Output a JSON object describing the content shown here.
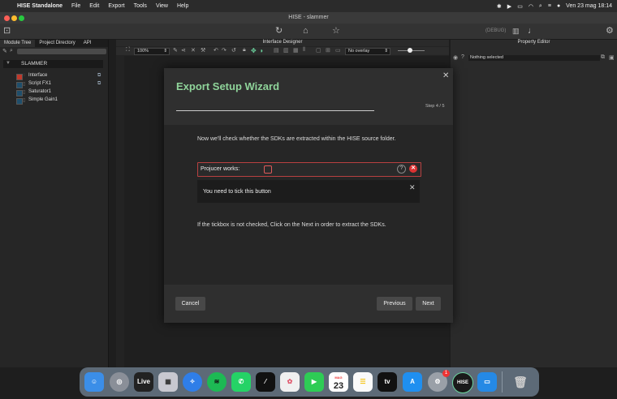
{
  "menubar": {
    "apple": "",
    "app_name": "HISE Standalone",
    "menus": [
      "File",
      "Edit",
      "Export",
      "Tools",
      "View",
      "Help"
    ],
    "clock": "Ven 23 mag  18:14"
  },
  "window": {
    "title": "HISE - slammer"
  },
  "toolbar": {
    "debug_label": "(DEBUG)"
  },
  "left_panel": {
    "tabs": [
      "Module Tree",
      "Project Directory",
      "API"
    ],
    "root_label": "SLAMMER",
    "modules": [
      {
        "label": "Interface",
        "color": "#c0392b"
      },
      {
        "label": "Script FX1",
        "color": "#1f4e6b"
      },
      {
        "label": "Saturator1",
        "color": "#1f4e6b"
      },
      {
        "label": "Simple Gain1",
        "color": "#1f4e6b"
      }
    ]
  },
  "center": {
    "header": "Interface Designer",
    "zoom": "100%",
    "overlay": "No overlay"
  },
  "right_panel": {
    "header": "Property Editor",
    "selection": "Nothing selected"
  },
  "wizard": {
    "title": "Export Setup Wizard",
    "step": "Step 4 / 5",
    "progress": 0.8,
    "intro": "Now we'll check whether the SDKs are extracted within the HISE source folder.",
    "field_label": "Projucer works:",
    "note": "You need to tick this button",
    "hint": "If the tickbox is not checked, Click on the Next in order to extract the SDKs.",
    "cancel": "Cancel",
    "previous": "Previous",
    "next": "Next"
  },
  "dock": {
    "live_label": "Live",
    "calendar_month": "MAG",
    "calendar_day": "23",
    "tv_label": "tv",
    "hise_label": "HISE",
    "badge": "1"
  }
}
